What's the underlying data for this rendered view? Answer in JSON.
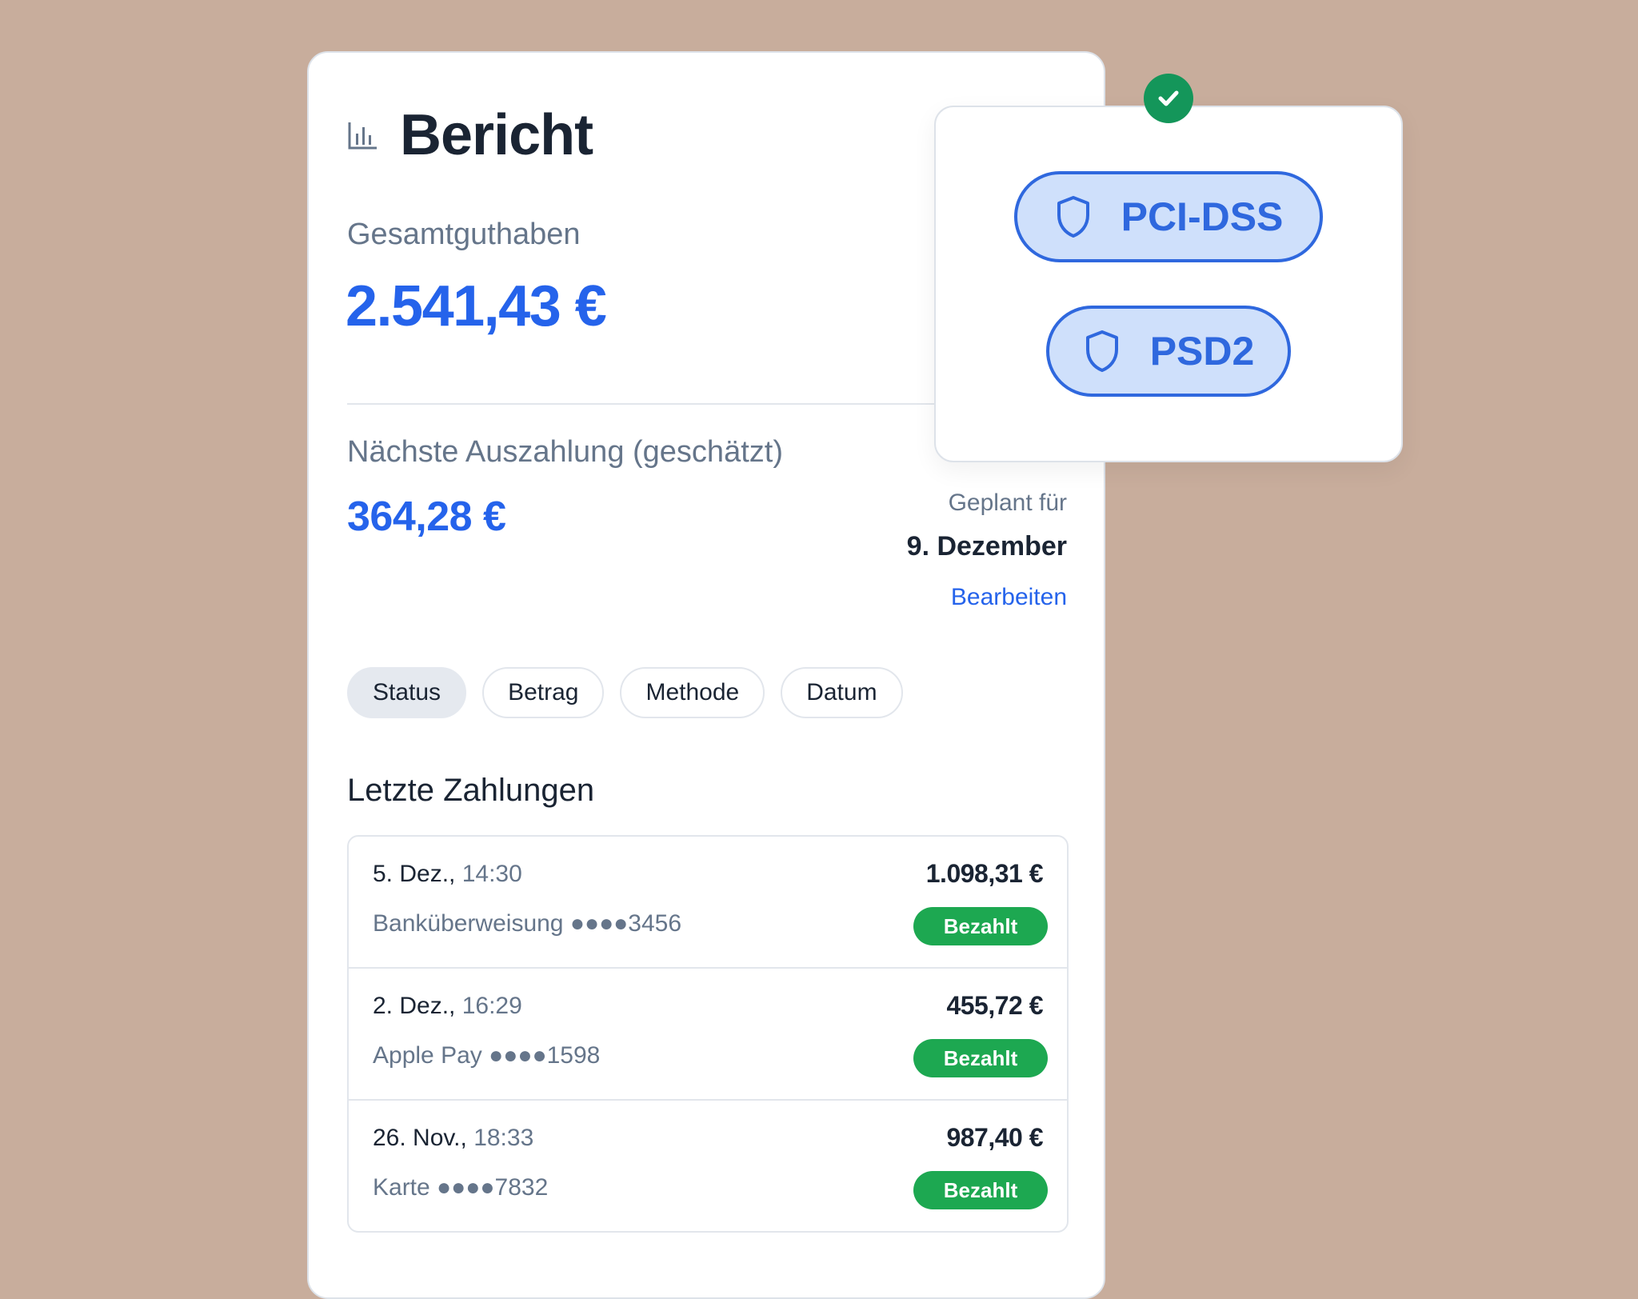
{
  "report": {
    "title": "Bericht",
    "balance_label": "Gesamtguthaben",
    "balance_amount": "2.541,43 €",
    "payout_label": "Nächste Auszahlung (geschätzt)",
    "payout_amount": "364,28 €",
    "scheduled_label": "Geplant für",
    "scheduled_date": "9. Dezember",
    "edit_label": "Bearbeiten"
  },
  "filters": [
    {
      "label": "Status",
      "active": true
    },
    {
      "label": "Betrag",
      "active": false
    },
    {
      "label": "Methode",
      "active": false
    },
    {
      "label": "Datum",
      "active": false
    }
  ],
  "payments": {
    "title": "Letzte Zahlungen",
    "rows": [
      {
        "date": "5. Dez.,",
        "time": "14:30",
        "method": "Banküberweisung ●●●●3456",
        "amount": "1.098,31 €",
        "status": "Bezahlt"
      },
      {
        "date": "2. Dez.,",
        "time": "16:29",
        "method": "Apple Pay ●●●●1598",
        "amount": "455,72 €",
        "status": "Bezahlt"
      },
      {
        "date": "26. Nov.,",
        "time": "18:33",
        "method": "Karte ●●●●7832",
        "amount": "987,40 €",
        "status": "Bezahlt"
      }
    ]
  },
  "compliance": {
    "badges": [
      "PCI-DSS",
      "PSD2"
    ],
    "check_icon": "check-icon",
    "shield_icon": "shield-icon"
  },
  "colors": {
    "background": "#c8ad9c",
    "accent": "#2563eb",
    "paid": "#1da851",
    "check": "#14965a",
    "pill_bg": "#cfe0fb"
  }
}
